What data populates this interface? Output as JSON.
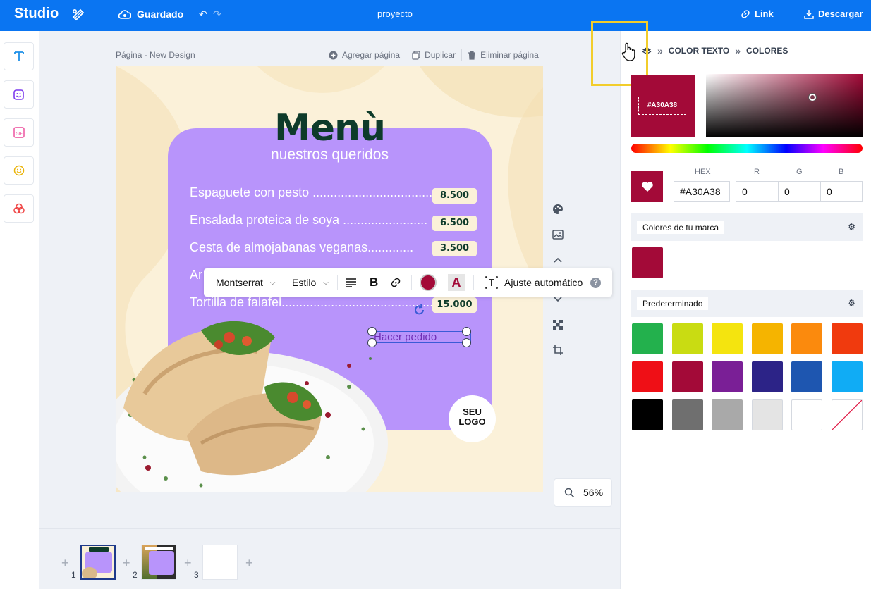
{
  "topbar": {
    "brand": "Studio",
    "saved_label": "Guardado",
    "project_name": "proyecto",
    "link_label": "Link",
    "download_label": "Descargar"
  },
  "page": {
    "title": "Página - New Design",
    "add_label": "Agregar página",
    "duplicate_label": "Duplicar",
    "delete_label": "Eliminar página"
  },
  "design": {
    "title": "Menù",
    "subtitle": "nuestros queridos",
    "items": [
      {
        "name": "Espaguete con pesto ......................................",
        "price": "8.500"
      },
      {
        "name": "Ensalada proteica de soya ........................",
        "price": "6.500"
      },
      {
        "name": "Cesta de almojabanas veganas.............",
        "price": "3.500"
      },
      {
        "name": "Ar",
        "price": ""
      },
      {
        "name": "Tortilla de falafel...................................................",
        "price": "15.000"
      }
    ],
    "order_text": "Hacer pedido",
    "logo_line1": "SEU",
    "logo_line2": "LOGO"
  },
  "text_toolbar": {
    "font": "Montserrat",
    "style": "Estilo",
    "auto_fit": "Ajuste automático"
  },
  "zoom": "56%",
  "pages": [
    "1",
    "2",
    "3"
  ],
  "panel": {
    "crumb1": "COLOR TEXTO",
    "crumb2": "COLORES",
    "selected_hex": "#A30A38",
    "hex_label": "HEX",
    "r_label": "R",
    "g_label": "G",
    "b_label": "B",
    "hex_value": "#A30A38",
    "r_value": "0",
    "g_value": "0",
    "b_value": "0",
    "brand_colors_title": "Colores de tu marca",
    "default_title": "Predeterminado",
    "brand_colors": [
      "#a30a38"
    ],
    "default_colors": [
      "#23b14d",
      "#c9dc12",
      "#f4e40f",
      "#f5b400",
      "#fb8a0d",
      "#f03a0e",
      "#ef0f16",
      "#a30a38",
      "#7a1f96",
      "#2c2387",
      "#1e56b0",
      "#10acf5",
      "#000000",
      "#6f6f6f",
      "#a9a9a9",
      "#e4e4e4",
      "#ffffff",
      "none"
    ]
  }
}
